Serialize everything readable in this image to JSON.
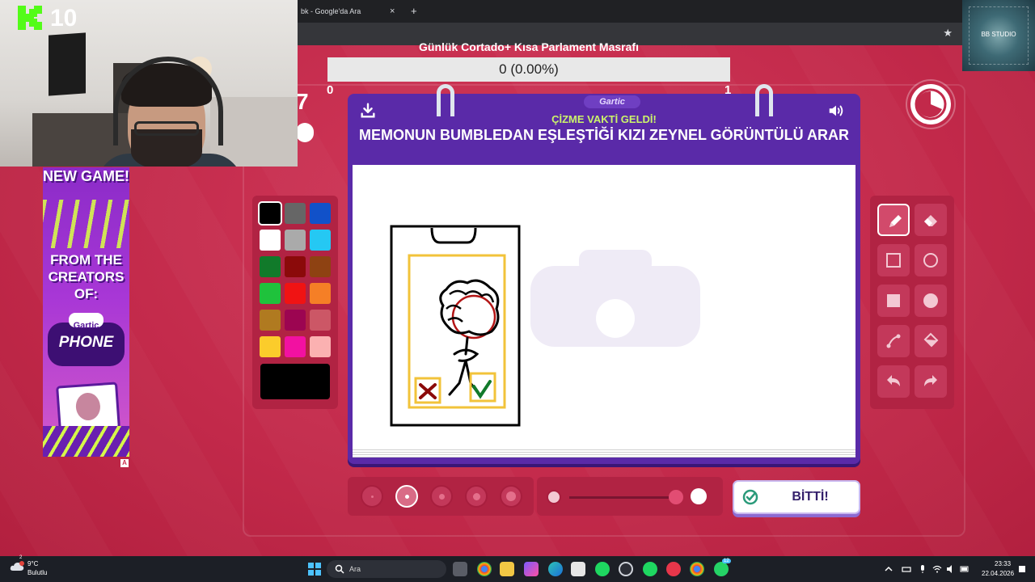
{
  "overlay": {
    "channel_number": "10",
    "studio_label": "BB STUDIO"
  },
  "browser": {
    "tab_title": "bk - Google'da Ara",
    "tab_close": "×",
    "new_tab": "+",
    "bookmark_icon": "★"
  },
  "counter": {
    "title": "Günlük Cortado+ Kısa Parlament Masrafı",
    "value_text": "0 (0.00%)",
    "progress_fraction": 0,
    "min_label": "0",
    "max_label": "1"
  },
  "ad": {
    "headline": "NEW GAME!",
    "tagline": "FROM THE CREATORS OF:",
    "logo_top": "Gartic",
    "logo_bottom": "PHONE",
    "badge": "A"
  },
  "game": {
    "brand": "Gartic",
    "subtitle": "ÇİZME VAKTİ GELDİ!",
    "prompt": "MEMONUN BUMBLEDAN EŞLEŞTİĞİ KIZI ZEYNEL GÖRÜNTÜLÜ ARAR",
    "left_fragment": "7",
    "watermark_top": "Gartic",
    "watermark_bottom": "PHONE",
    "palette": [
      "#000000",
      "#666666",
      "#1151c9",
      "#ffffff",
      "#aaaaaa",
      "#25c8f3",
      "#117a2a",
      "#8b0a0a",
      "#8e4212",
      "#1fc23c",
      "#f01313",
      "#f57f26",
      "#b07a20",
      "#9c0551",
      "#cc5766",
      "#fbcc2b",
      "#f211a1",
      "#fbb1b1"
    ],
    "current_color": "#000000",
    "tools": [
      "pencil-icon",
      "eraser-icon",
      "rectangle-outline-icon",
      "circle-outline-icon",
      "rectangle-filled-icon",
      "circle-filled-icon",
      "line-icon",
      "bucket-fill-icon",
      "undo-icon",
      "redo-icon"
    ],
    "selected_tool": "pencil",
    "brush_size_selected": 2,
    "opacity_level": 1.0,
    "done_label": "BİTTİ!"
  },
  "taskbar": {
    "temperature": "9°C",
    "weather": "Bulutlu",
    "weather_badge": "2",
    "search_placeholder": "Ara",
    "whatsapp_badge": "12",
    "time": "23:33",
    "date": "22.04.2026"
  }
}
